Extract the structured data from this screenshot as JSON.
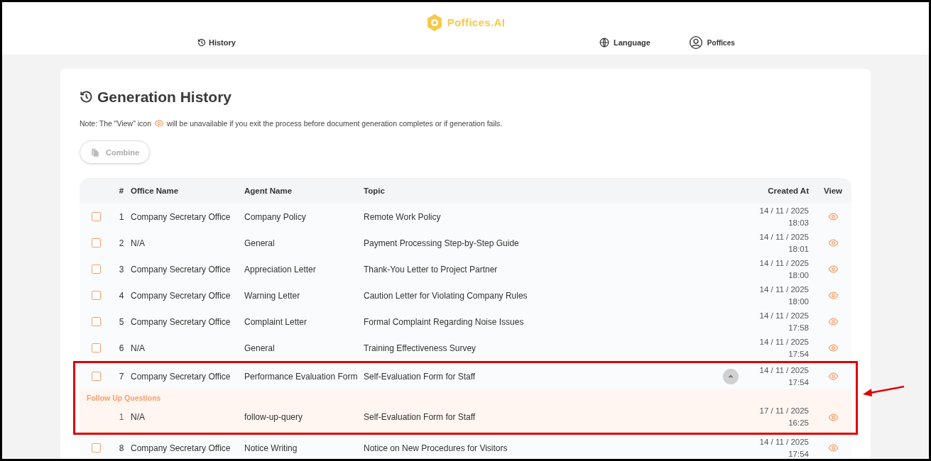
{
  "header": {
    "logo": "Poffices.AI",
    "nav": [
      {
        "label": "History",
        "kind": "history"
      },
      {
        "label": "Language",
        "kind": "language"
      },
      {
        "label": "Poffices",
        "kind": "profile"
      }
    ]
  },
  "page": {
    "title": "Generation History",
    "note_before": "Note: The \"View\" icon",
    "note_after": "will be unavailable if you exit the process before document generation completes or if generation fails.",
    "combine": {
      "label": "Combine",
      "disabled": true
    }
  },
  "table": {
    "columns": [
      "#",
      "Office Name",
      "Agent Name",
      "Topic",
      "Created At",
      "View"
    ],
    "rows": [
      {
        "checked": false,
        "highlighted": false,
        "number": "1",
        "office": "Company Secretary Office",
        "agent": "Company Policy",
        "topic": "Remote Work Policy",
        "date": "14 / 11 / 2025",
        "time": "18:03"
      },
      {
        "checked": false,
        "highlighted": false,
        "number": "2",
        "office": "N/A",
        "agent": "General",
        "topic": "Payment Processing Step-by-Step Guide",
        "date": "14 / 11 / 2025",
        "time": "18:01"
      },
      {
        "checked": false,
        "highlighted": false,
        "number": "3",
        "office": "Company Secretary Office",
        "agent": "Appreciation Letter",
        "topic": "Thank-You Letter to Project Partner",
        "date": "14 / 11 / 2025",
        "time": "18:00"
      },
      {
        "checked": false,
        "highlighted": false,
        "number": "4",
        "office": "Company Secretary Office",
        "agent": "Warning Letter",
        "topic": "Caution Letter for Violating Company Rules",
        "date": "14 / 11 / 2025",
        "time": "18:00"
      },
      {
        "checked": false,
        "highlighted": false,
        "number": "5",
        "office": "Company Secretary Office",
        "agent": "Complaint Letter",
        "topic": "Formal Complaint Regarding Noise Issues",
        "date": "14 / 11 / 2025",
        "time": "17:58"
      },
      {
        "checked": false,
        "highlighted": false,
        "number": "6",
        "office": "N/A",
        "agent": "General",
        "topic": "Training Effectiveness Survey",
        "date": "14 / 11 / 2025",
        "time": "17:54"
      },
      {
        "checked": false,
        "highlighted": true,
        "number": "7",
        "office": "Company Secretary Office",
        "agent": "Performance Evaluation Form",
        "topic": "Self-Evaluation Form for Staff",
        "date": "14 / 11 / 2025",
        "time": "17:54",
        "expanded": true,
        "follow_up_title": "Follow Up Questions",
        "follow_ups": [
          {
            "number": "1",
            "office": "N/A",
            "agent": "follow-up-query",
            "topic": "Self-Evaluation Form for Staff",
            "date": "17 / 11 / 2025",
            "time": "16:25"
          }
        ]
      },
      {
        "checked": false,
        "highlighted": false,
        "number": "8",
        "office": "Company Secretary Office",
        "agent": "Notice Writing",
        "topic": "Notice on New Procedures for Visitors",
        "date": "14 / 11 / 2025",
        "time": "17:54"
      }
    ]
  }
}
